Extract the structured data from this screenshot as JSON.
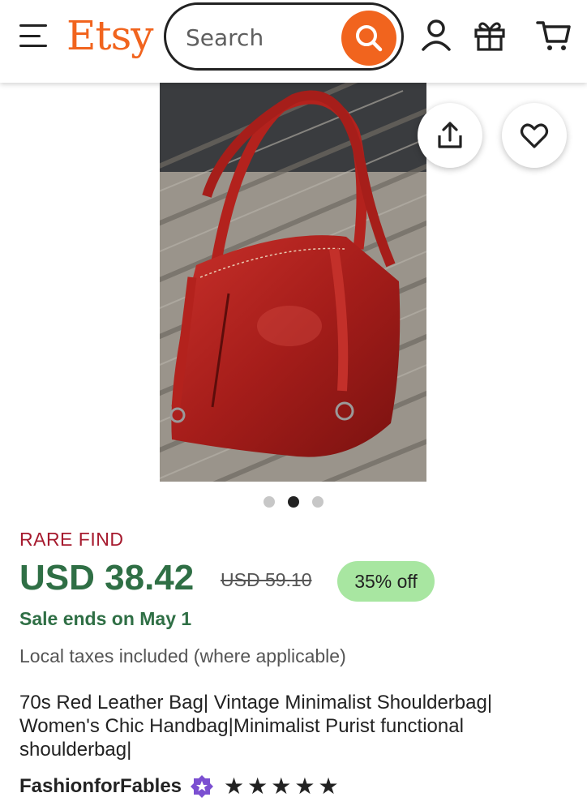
{
  "header": {
    "logo": "Etsy",
    "search_placeholder": "Search"
  },
  "carousel": {
    "count": 3,
    "active_index": 1
  },
  "product": {
    "badge": "RARE FIND",
    "price": "USD 38.42",
    "original_price": "USD 59.10",
    "discount": "35% off",
    "sale_end": "Sale ends on May 1",
    "tax_note": "Local taxes included (where applicable)",
    "title": "70s Red Leather Bag| Vintage Minimalist Shoulderbag| Women's Chic Handbag|Minimalist Purist functional shoulderbag|",
    "shop_name": "FashionforFables",
    "rating": 5,
    "stars": [
      "★",
      "★",
      "★",
      "★",
      "★"
    ]
  },
  "colors": {
    "brand": "#f1641e",
    "price_green": "#2f6f45",
    "rare_red": "#a61a2e",
    "discount_bg": "#a8e6a1",
    "star_seller_purple": "#7b4fd1"
  }
}
